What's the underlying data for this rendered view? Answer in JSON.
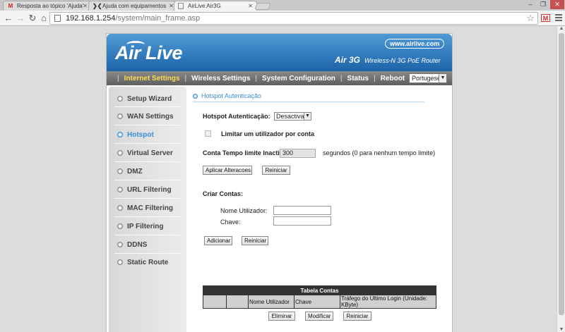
{
  "browser": {
    "tabs": [
      {
        "title": "Resposta ao tópico 'Ajuda'",
        "icon": "gmail-icon",
        "glyph": "M"
      },
      {
        "title": "Ajuda com equipamentos",
        "icon": "forum-icon",
        "glyph": "❯❮"
      },
      {
        "title": "AirLive Air3G",
        "icon": "page-icon",
        "glyph": ""
      }
    ],
    "url_host": "192.168.1.254",
    "url_path": "/system/main_frame.asp",
    "nav": {
      "back": "←",
      "forward": "→",
      "reload": "↻",
      "home": "⌂"
    },
    "window": {
      "minimize": "–",
      "maximize": "❐",
      "close": "✕"
    },
    "bookmark_star": "☆",
    "extension_glyph": "M"
  },
  "router": {
    "logo": "Air Live",
    "site_url": "www.airlive.com",
    "product_name": "Air 3G",
    "product_desc": "Wireless-N 3G PoE Router",
    "menu": [
      {
        "label": "Internet Settings",
        "active": true
      },
      {
        "label": "Wireless Settings",
        "active": false
      },
      {
        "label": "System Configuration",
        "active": false
      },
      {
        "label": "Status",
        "active": false
      },
      {
        "label": "Reboot",
        "active": false
      }
    ],
    "language": "Portugese",
    "sidebar": [
      {
        "label": "Setup Wizard",
        "active": false
      },
      {
        "label": "WAN Settings",
        "active": false
      },
      {
        "label": "Hotspot",
        "active": true
      },
      {
        "label": "Virtual Server",
        "active": false
      },
      {
        "label": "DMZ",
        "active": false
      },
      {
        "label": "URL Filtering",
        "active": false
      },
      {
        "label": "MAC Filtering",
        "active": false
      },
      {
        "label": "IP Filtering",
        "active": false
      },
      {
        "label": "DDNS",
        "active": false
      },
      {
        "label": "Static Route",
        "active": false
      }
    ]
  },
  "form": {
    "section_title": "Hotspot Autenticação",
    "auth_label": "Hotspot Autenticação:",
    "auth_value": "Desactivar",
    "limit_label": "Limitar um utilizador por conta",
    "limit_checked": false,
    "timeout_label": "Conta Tempo limite Inactivo:",
    "timeout_value": "300",
    "timeout_hint": "segundos (0 para nenhum tempo limite)",
    "apply_button": "Aplicar Alteracoes",
    "reset_button": "Reiniciar",
    "create_title": "Criar Contas:",
    "username_label": "Nome Utilizador:",
    "username_value": "",
    "password_label": "Chave:",
    "password_value": "",
    "add_button": "Adicionar",
    "reset_button_2": "Reiniciar",
    "table": {
      "title": "Tabela Contas",
      "columns": [
        "",
        "",
        "Nome Utilizador",
        "Chave",
        "Tráfego do Ultimo Login (Unidade: KByte)"
      ]
    },
    "delete_button": "Eliminar",
    "modify_button": "Modificar",
    "reset_button_3": "Reiniciar"
  }
}
